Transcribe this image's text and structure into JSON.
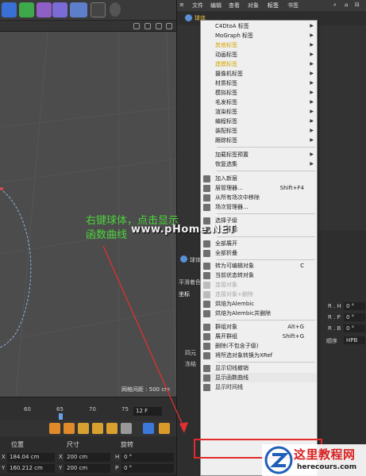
{
  "right_menubar": {
    "items": [
      "文件",
      "编辑",
      "查看",
      "对象",
      "标签",
      "书签"
    ]
  },
  "object_row": {
    "label": "球体"
  },
  "tag_menu": {
    "items": [
      {
        "label": "C4DtoA 标签",
        "submenu": true
      },
      {
        "label": "MoGraph 标签",
        "submenu": true
      },
      {
        "label": "其他标签",
        "submenu": true,
        "accent": true
      },
      {
        "label": "动画标签",
        "submenu": true
      },
      {
        "label": "建模标签",
        "submenu": true,
        "accent": true
      },
      {
        "label": "摄像机标签",
        "submenu": true
      },
      {
        "label": "材质标签",
        "submenu": true
      },
      {
        "label": "模拟标签",
        "submenu": true
      },
      {
        "label": "毛发标签",
        "submenu": true
      },
      {
        "label": "渲染标签",
        "submenu": true
      },
      {
        "label": "编程标签",
        "submenu": true
      },
      {
        "label": "装配标签",
        "submenu": true
      },
      {
        "label": "跟踪标签",
        "submenu": true
      },
      {
        "label": "加载标签预置",
        "submenu": true
      },
      {
        "label": "恢复选集",
        "submenu": true
      },
      {
        "label": "加入新层",
        "submenu": false
      },
      {
        "label": "层管理器...",
        "submenu": false,
        "shortcut": "Shift+F4"
      },
      {
        "label": "从所有场次中移除",
        "submenu": false
      },
      {
        "label": "场次管理器...",
        "submenu": false
      },
      {
        "label": "选择子级",
        "submenu": false
      },
      {
        "label": "设为根部",
        "submenu": false
      },
      {
        "label": "全部展开",
        "submenu": false
      },
      {
        "label": "全部折叠",
        "submenu": false
      },
      {
        "label": "转为可编辑对象",
        "submenu": false,
        "shortcut": "C"
      },
      {
        "label": "当前状态转对象",
        "submenu": false
      },
      {
        "label": "连接对象",
        "submenu": false,
        "disabled": true
      },
      {
        "label": "连接对象+删除",
        "submenu": false,
        "disabled": true
      },
      {
        "label": "烘焙为Alembic",
        "submenu": false
      },
      {
        "label": "烘焙为Alembic并删除",
        "submenu": false
      },
      {
        "label": "群组对象",
        "submenu": false,
        "shortcut": "Alt+G"
      },
      {
        "label": "展开群组",
        "submenu": false,
        "shortcut": "Shift+G"
      },
      {
        "label": "删除(不包含子级)",
        "submenu": false
      },
      {
        "label": "将所选对象转换为XRef",
        "submenu": false
      },
      {
        "label": "显示切线撤销",
        "submenu": false
      },
      {
        "label": "显示函数曲线",
        "submenu": false,
        "highlight": true
      },
      {
        "label": "显示时间线",
        "submenu": false
      }
    ]
  },
  "annotation": {
    "line1": "右键球体，点击显示",
    "line2": "函数曲线"
  },
  "watermark_mid": "www.pHome.NET",
  "viewport": {
    "grid_label": "网格间距 : 500 cm"
  },
  "timeline": {
    "ticks": [
      "60",
      "65",
      "70",
      "75"
    ],
    "frame_value": "12 F"
  },
  "coords": {
    "header_pos": "位置",
    "header_size": "尺寸",
    "header_rot": "旋转",
    "rows": [
      {
        "axis": "X",
        "pos": "184.04 cm",
        "size_axis": "X",
        "size": "200 cm",
        "rot_axis": "H",
        "rot": "0 °"
      },
      {
        "axis": "Y",
        "pos": "160.212 cm",
        "size_axis": "Y",
        "size": "200 cm",
        "rot_axis": "P",
        "rot": "0 °"
      }
    ]
  },
  "attributes": {
    "coord_label": "坐标",
    "rows": [
      {
        "label": "R . H",
        "value": "0 °"
      },
      {
        "label": "R . P",
        "value": "0 °"
      },
      {
        "label": "R . B",
        "value": "0 °"
      }
    ],
    "order_label": "顺序",
    "order_value": "HPB",
    "quat_label": "四元",
    "freeze_label": "冻结",
    "tab_label": "平滑着色",
    "obj_label": "球体"
  },
  "logo": {
    "cn": "这里教程网",
    "en": "herecours.com"
  },
  "colors": {
    "menu_bg": "#efefef",
    "accent_text": "#d6a400",
    "annotation_green": "#4dd43d",
    "red_box": "#e32b2b"
  }
}
